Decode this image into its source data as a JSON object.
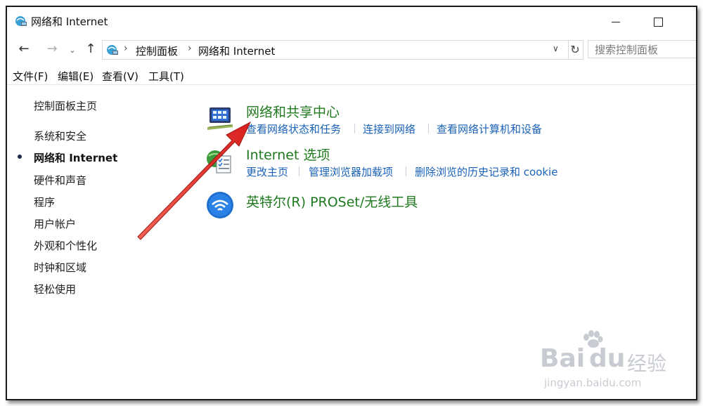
{
  "window": {
    "title": "网络和 Internet"
  },
  "address": {
    "crumbs": [
      "控制面板",
      "网络和 Internet"
    ],
    "search_placeholder": "搜索控制面板"
  },
  "menu": [
    "文件(F)",
    "编辑(E)",
    "查看(V)",
    "工具(T)"
  ],
  "sidebar": {
    "home": "控制面板主页",
    "items": [
      "系统和安全",
      "网络和 Internet",
      "硬件和声音",
      "程序",
      "用户帐户",
      "外观和个性化",
      "时钟和区域",
      "轻松使用"
    ],
    "active_index": 1
  },
  "categories": [
    {
      "title": "网络和共享中心",
      "icon": "network-sharing-icon",
      "links": [
        "查看网络状态和任务",
        "连接到网络",
        "查看网络计算机和设备"
      ]
    },
    {
      "title": "Internet 选项",
      "icon": "internet-options-icon",
      "links": [
        "更改主页",
        "管理浏览器加载项",
        "删除浏览的历史记录和 cookie"
      ]
    },
    {
      "title": "英特尔(R) PROSet/无线工具",
      "icon": "intel-wireless-icon",
      "links": []
    }
  ],
  "annotation": {
    "arrow_color": "#e02020",
    "points_to": "网络和共享中心"
  },
  "watermark": {
    "brand": "Bai",
    "brand2": "du",
    "suffix": "经验",
    "url": "jingyan.baidu.com"
  }
}
